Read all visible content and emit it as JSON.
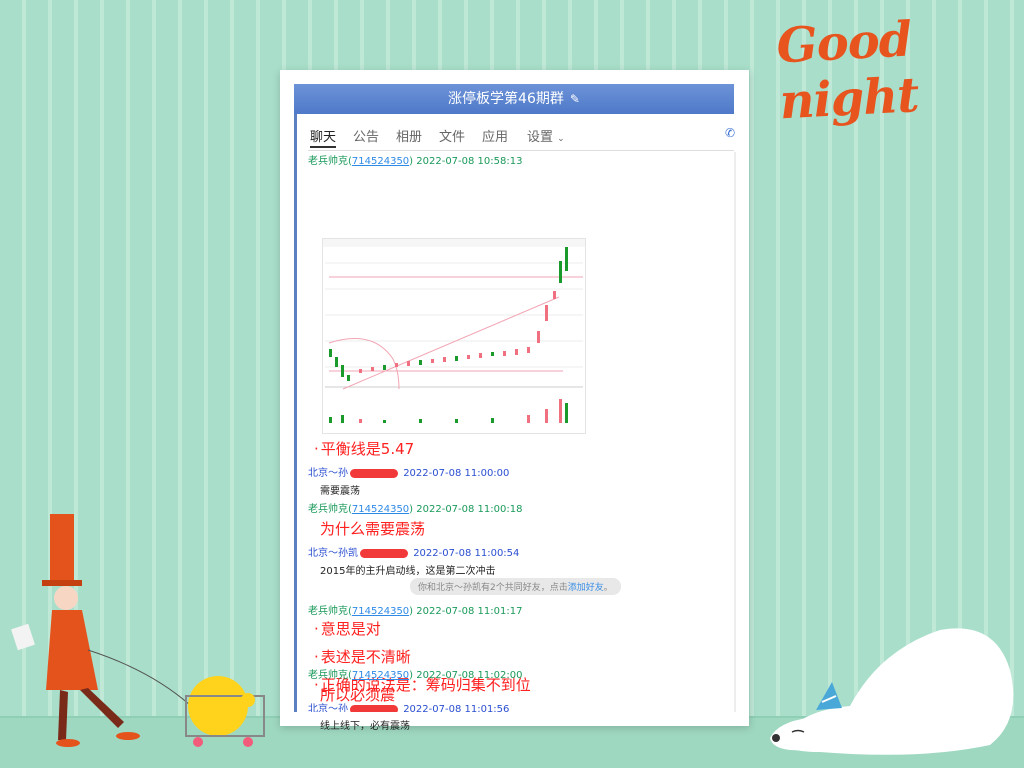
{
  "background": {
    "headline": "Good night"
  },
  "window": {
    "title": "涨停板学第46期群",
    "tabs": [
      "聊天",
      "公告",
      "相册",
      "文件",
      "应用",
      "设置"
    ],
    "active_tab": "聊天"
  },
  "messages": [
    {
      "sender": "老兵帅克",
      "qq": "714524350",
      "time": "2022-07-08 10:58:13",
      "content": "[stock chart image]"
    },
    {
      "bullet_text": "平衡线是5.47"
    },
    {
      "sender": "北京～孙",
      "time": "2022-07-08 11:00:00",
      "content": "需要震荡"
    },
    {
      "sender": "老兵帅克",
      "qq": "714524350",
      "time": "2022-07-08 11:00:18",
      "content": "为什么需要震荡"
    },
    {
      "sender": "北京～孙凯",
      "time": "2022-07-08 11:00:54",
      "content": "2015年的主升启动线，这是第二次冲击"
    },
    {
      "notice": "你和北京～孙凯有2个共同好友，点击",
      "notice_link": "添加好友",
      "notice_end": "。"
    },
    {
      "sender": "老兵帅克",
      "qq": "714524350",
      "time": "2022-07-08 11:01:17",
      "bullets": [
        "意思是对",
        "表述是不清晰",
        "正确的说法是：筹码归集不到位"
      ]
    },
    {
      "sender": "北京～孙",
      "time": "2022-07-08 11:01:56",
      "content": "线上线下，必有震荡"
    },
    {
      "sender": "老兵帅克",
      "qq": "714524350",
      "time": "2022-07-08 11:02:00",
      "content": "所以必须震"
    }
  ],
  "colors": {
    "title_bar": "#5b80cc",
    "sender_green": "#1a9a5a",
    "sender_blue": "#2a4ed0",
    "emphasis_red": "#ff2020",
    "headline_orange": "#e8541e"
  },
  "icons": [
    "edit-icon",
    "chevron-down-icon",
    "phone-icon"
  ]
}
